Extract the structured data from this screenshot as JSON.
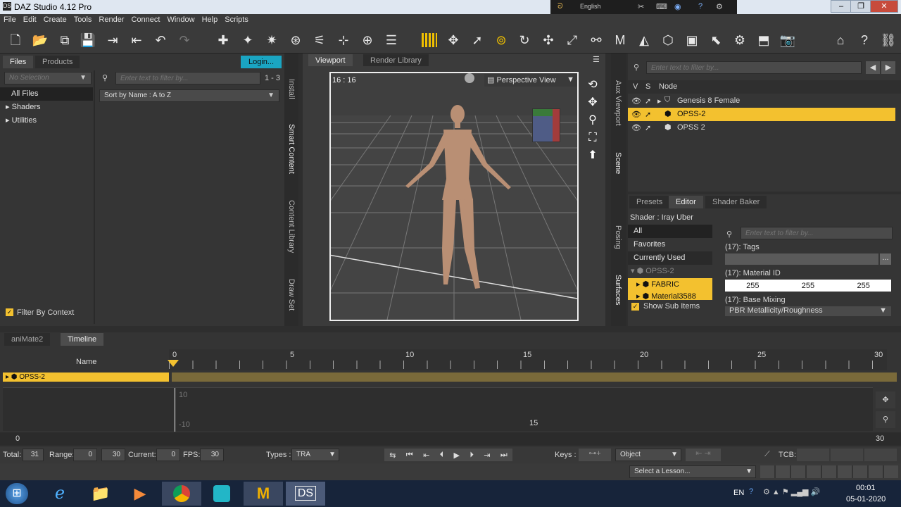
{
  "app": {
    "title": "DAZ Studio 4.12 Pro"
  },
  "lang_bar": {
    "language": "English"
  },
  "menu": [
    "File",
    "Edit",
    "Create",
    "Tools",
    "Render",
    "Connect",
    "Window",
    "Help",
    "Scripts"
  ],
  "left_panel": {
    "tabs": [
      "Files",
      "Products"
    ],
    "login": "Login...",
    "selection": "No Selection",
    "filter_placeholder": "Enter text to filter by...",
    "range": "1 - 3",
    "sort": "Sort by Name : A to Z",
    "tree": [
      "All Files",
      "Shaders",
      "Utilities"
    ],
    "filter_context": "Filter By Context"
  },
  "left_vtabs": [
    "Install",
    "Smart Content",
    "Content Library",
    "Draw Set"
  ],
  "viewport": {
    "tabs": [
      "Viewport",
      "Render Library"
    ],
    "aspect": "16 : 16",
    "view": "Perspective View"
  },
  "right_vtabs": [
    "Aux Viewport",
    "Scene",
    "Posing",
    "Surfaces"
  ],
  "scene": {
    "filter_placeholder": "Enter text to filter by...",
    "cols": [
      "V",
      "S",
      "Node"
    ],
    "nodes": [
      "Genesis 8 Female",
      "OPSS-2",
      "OPSS 2"
    ]
  },
  "surfaces": {
    "tabs": [
      "Presets",
      "Editor",
      "Shader Baker"
    ],
    "shader": "Shader : Iray Uber",
    "list": [
      "All",
      "Favorites",
      "Currently Used",
      "OPSS-2",
      "FABRIC",
      "Material3588"
    ],
    "show_sub": "Show Sub Items",
    "filter_placeholder": "Enter text to filter by...",
    "props": {
      "tags": "(17): Tags",
      "tags_btn": "...",
      "matid": "(17): Material ID",
      "rgb": [
        "255",
        "255",
        "255"
      ],
      "base": "(17): Base Mixing",
      "base_val": "PBR Metallicity/Roughness"
    }
  },
  "timeline": {
    "tabs": [
      "aniMate2",
      "Timeline"
    ],
    "name_col": "Name",
    "ticks": [
      "0",
      "5",
      "10",
      "15",
      "20",
      "25",
      "30"
    ],
    "track": "OPSS-2",
    "graph": [
      "10",
      "-10",
      "15"
    ],
    "start": "0",
    "end": "30",
    "total_label": "Total:",
    "total": "31",
    "range_label": "Range:",
    "range_a": "0",
    "range_b": "30",
    "current_label": "Current:",
    "current": "0",
    "fps_label": "FPS:",
    "fps": "30",
    "types_label": "Types :",
    "types": "TRA",
    "keys_label": "Keys :",
    "object": "Object",
    "tcb": "TCB:",
    "lesson": "Select a Lesson..."
  },
  "taskbar": {
    "lang": "EN",
    "time": "00:01",
    "date": "05-01-2020"
  }
}
